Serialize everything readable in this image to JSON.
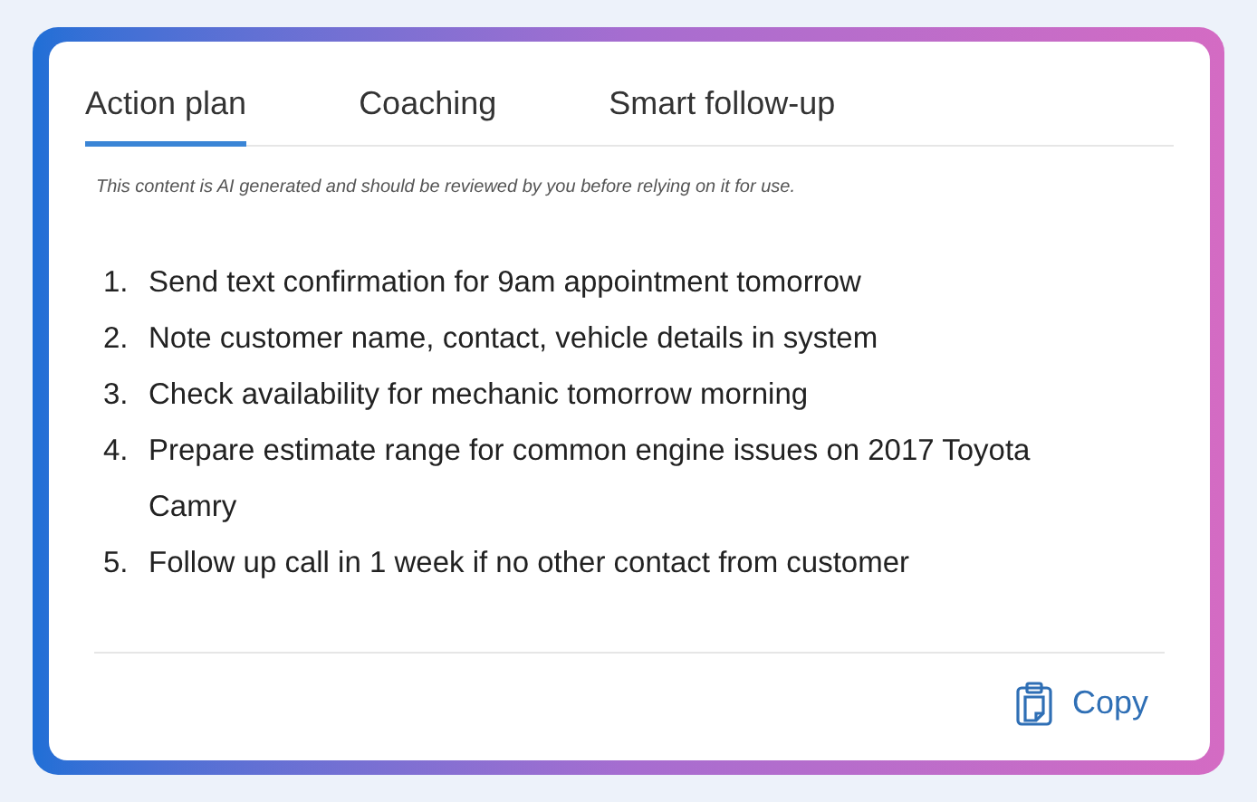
{
  "tabs": [
    {
      "label": "Action plan",
      "selected": true
    },
    {
      "label": "Coaching",
      "selected": false
    },
    {
      "label": "Smart follow-up",
      "selected": false
    }
  ],
  "disclaimer": "This content is AI generated and should be reviewed by you before relying on it for use.",
  "action_items": [
    {
      "number": "1.",
      "text": "Send text confirmation for 9am appointment tomorrow"
    },
    {
      "number": "2.",
      "text": "Note customer name, contact, vehicle details in system"
    },
    {
      "number": "3.",
      "text": "Check availability for mechanic tomorrow morning"
    },
    {
      "number": "4.",
      "text": "Prepare estimate range for common engine issues on 2017 Toyota Camry"
    },
    {
      "number": "5.",
      "text": "Follow up call in 1 week if no other contact from customer"
    }
  ],
  "copy_button": {
    "label": "Copy"
  }
}
